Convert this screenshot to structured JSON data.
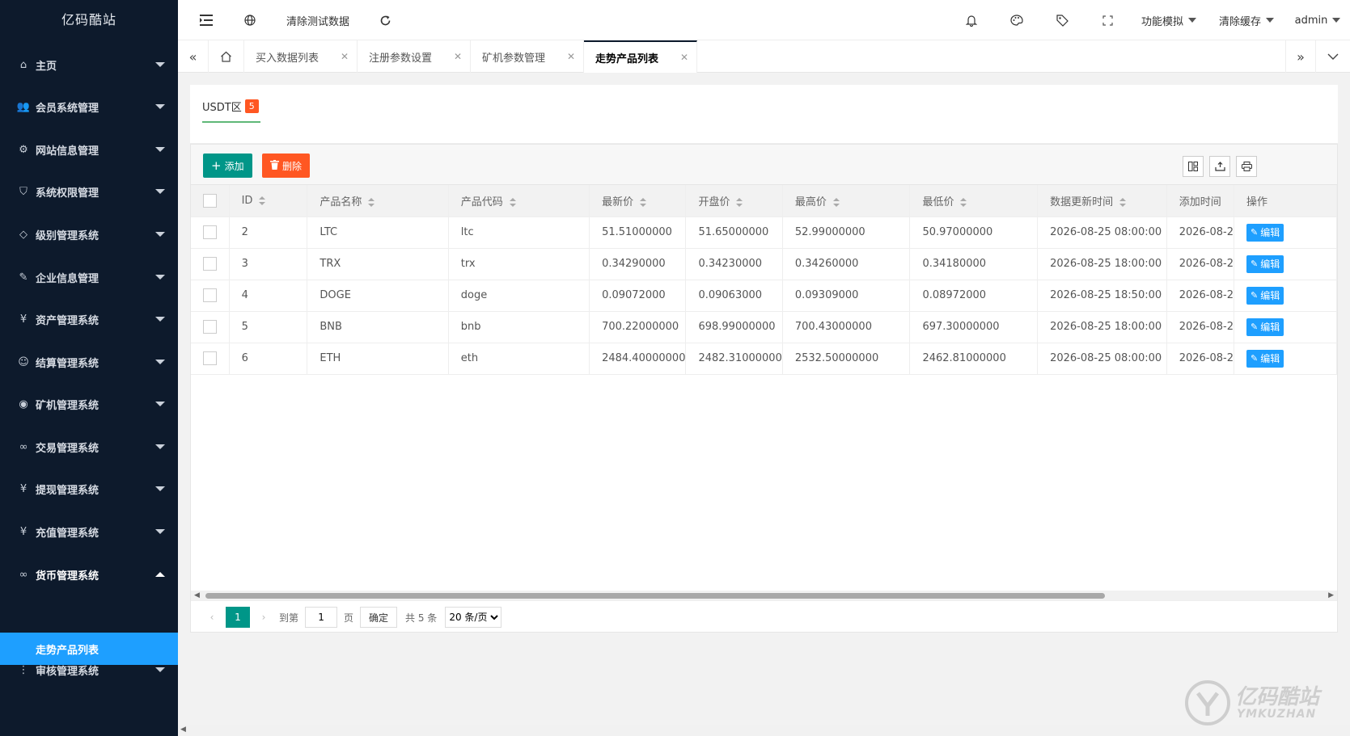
{
  "app": {
    "logo": "亿码酷站"
  },
  "sidebar": {
    "items": [
      {
        "label": "主页",
        "icon": "home-icon",
        "glyph": "⌂"
      },
      {
        "label": "会员系统管理",
        "icon": "users-icon",
        "glyph": "👥"
      },
      {
        "label": "网站信息管理",
        "icon": "gear-icon",
        "glyph": "⚙"
      },
      {
        "label": "系统权限管理",
        "icon": "shield-icon",
        "glyph": "⛉"
      },
      {
        "label": "级别管理系统",
        "icon": "diamond-icon",
        "glyph": "◇"
      },
      {
        "label": "企业信息管理",
        "icon": "edit-doc-icon",
        "glyph": "✎"
      },
      {
        "label": "资产管理系统",
        "icon": "yen-icon",
        "glyph": "¥"
      },
      {
        "label": "结算管理系统",
        "icon": "smile-icon",
        "glyph": "☺"
      },
      {
        "label": "矿机管理系统",
        "icon": "globe-icon",
        "glyph": "◉"
      },
      {
        "label": "交易管理系统",
        "icon": "link-icon",
        "glyph": "∞"
      },
      {
        "label": "提现管理系统",
        "icon": "yen-icon",
        "glyph": "¥"
      },
      {
        "label": "充值管理系统",
        "icon": "yen-icon",
        "glyph": "¥"
      },
      {
        "label": "货币管理系统",
        "icon": "link-icon",
        "glyph": "∞"
      },
      {
        "label": "审核管理系统",
        "icon": "more-vertical-icon",
        "glyph": "⋮"
      }
    ],
    "active_sub": "走势产品列表"
  },
  "header": {
    "clear_test_data": "清除测试数据",
    "feature_simulation": "功能模拟",
    "clear_cache": "清除缓存",
    "user": "admin"
  },
  "tabs": [
    {
      "label": "买入数据列表"
    },
    {
      "label": "注册参数设置"
    },
    {
      "label": "矿机参数管理"
    },
    {
      "label": "走势产品列表"
    }
  ],
  "section": {
    "tab_label": "USDT区",
    "count": "5"
  },
  "toolbar": {
    "add": "添加",
    "delete": "删除"
  },
  "table": {
    "headers": [
      "ID",
      "产品名称",
      "产品代码",
      "最新价",
      "开盘价",
      "最高价",
      "最低价",
      "数据更新时间",
      "添加时间",
      "操作"
    ],
    "edit_label": "编辑",
    "rows": [
      [
        "2",
        "LTC",
        "ltc",
        "51.51000000",
        "51.65000000",
        "52.99000000",
        "50.97000000",
        "2026-08-25 08:00:00",
        "2026-08-2"
      ],
      [
        "3",
        "TRX",
        "trx",
        "0.34290000",
        "0.34230000",
        "0.34260000",
        "0.34180000",
        "2026-08-25 18:00:00",
        "2026-08-2"
      ],
      [
        "4",
        "DOGE",
        "doge",
        "0.09072000",
        "0.09063000",
        "0.09309000",
        "0.08972000",
        "2026-08-25 18:50:00",
        "2026-08-2"
      ],
      [
        "5",
        "BNB",
        "bnb",
        "700.22000000",
        "698.99000000",
        "700.43000000",
        "697.30000000",
        "2026-08-25 18:00:00",
        "2026-08-2"
      ],
      [
        "6",
        "ETH",
        "eth",
        "2484.40000000",
        "2482.31000000",
        "2532.50000000",
        "2462.81000000",
        "2026-08-25 08:00:00",
        "2026-08-2"
      ]
    ]
  },
  "pager": {
    "current": "1",
    "goto_label": "到第",
    "goto_value": "1",
    "page_unit": "页",
    "confirm": "确定",
    "total": "共 5 条",
    "per_page": "20 条/页"
  },
  "watermark": {
    "brand": "亿码酷站",
    "domain": "YMKUZHAN"
  }
}
